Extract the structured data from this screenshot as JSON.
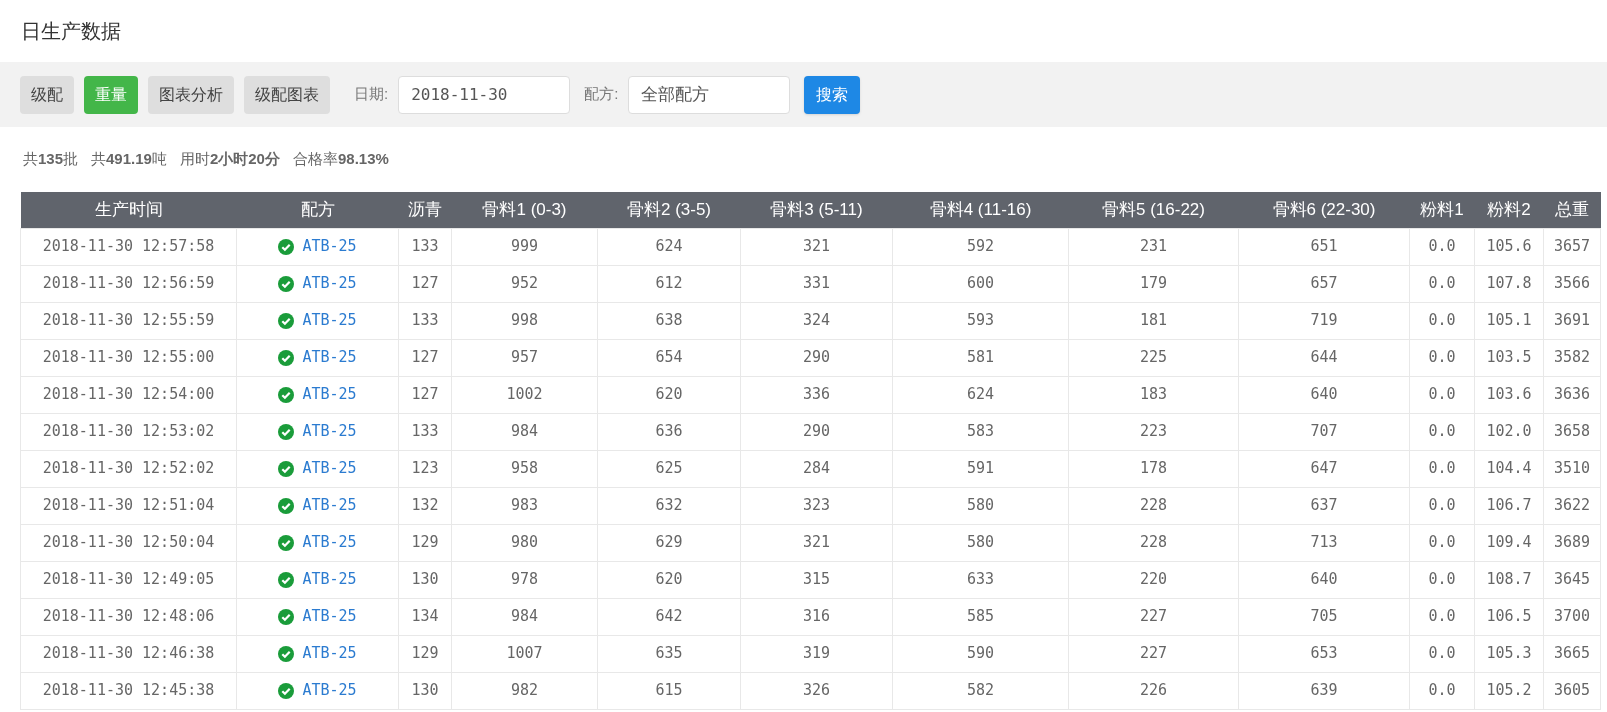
{
  "page_title": "日生产数据",
  "toolbar": {
    "tabs": [
      {
        "label": "级配",
        "selected": false
      },
      {
        "label": "重量",
        "selected": true
      },
      {
        "label": "图表分析",
        "selected": false
      },
      {
        "label": "级配图表",
        "selected": false
      }
    ],
    "date": {
      "label": "日期:",
      "value": "2018-11-30"
    },
    "recipe": {
      "label": "配方:",
      "value": "全部配方"
    },
    "search_button": "搜索"
  },
  "stats": [
    "共**135**批",
    "共**491.19**吨",
    "用时**2小时20分**",
    "合格率**98.13%**"
  ],
  "table": {
    "columns": [
      "生产时间",
      "配方",
      "沥青",
      "骨料1 (0-3)",
      "骨料2 (3-5)",
      "骨料3 (5-11)",
      "骨料4 (11-16)",
      "骨料5 (16-22)",
      "骨料6 (22-30)",
      "粉料1",
      "粉料2",
      "总重"
    ],
    "rows": [
      {
        "time": "2018-11-30 12:57:58",
        "passed": true,
        "recipe": "ATB-25",
        "values": [
          "133",
          "999",
          "624",
          "321",
          "592",
          "231",
          "651",
          "0.0",
          "105.6",
          "3657"
        ]
      },
      {
        "time": "2018-11-30 12:56:59",
        "passed": true,
        "recipe": "ATB-25",
        "values": [
          "127",
          "952",
          "612",
          "331",
          "600",
          "179",
          "657",
          "0.0",
          "107.8",
          "3566"
        ]
      },
      {
        "time": "2018-11-30 12:55:59",
        "passed": true,
        "recipe": "ATB-25",
        "values": [
          "133",
          "998",
          "638",
          "324",
          "593",
          "181",
          "719",
          "0.0",
          "105.1",
          "3691"
        ]
      },
      {
        "time": "2018-11-30 12:55:00",
        "passed": true,
        "recipe": "ATB-25",
        "values": [
          "127",
          "957",
          "654",
          "290",
          "581",
          "225",
          "644",
          "0.0",
          "103.5",
          "3582"
        ]
      },
      {
        "time": "2018-11-30 12:54:00",
        "passed": true,
        "recipe": "ATB-25",
        "values": [
          "127",
          "1002",
          "620",
          "336",
          "624",
          "183",
          "640",
          "0.0",
          "103.6",
          "3636"
        ]
      },
      {
        "time": "2018-11-30 12:53:02",
        "passed": true,
        "recipe": "ATB-25",
        "values": [
          "133",
          "984",
          "636",
          "290",
          "583",
          "223",
          "707",
          "0.0",
          "102.0",
          "3658"
        ]
      },
      {
        "time": "2018-11-30 12:52:02",
        "passed": true,
        "recipe": "ATB-25",
        "values": [
          "123",
          "958",
          "625",
          "284",
          "591",
          "178",
          "647",
          "0.0",
          "104.4",
          "3510"
        ]
      },
      {
        "time": "2018-11-30 12:51:04",
        "passed": true,
        "recipe": "ATB-25",
        "values": [
          "132",
          "983",
          "632",
          "323",
          "580",
          "228",
          "637",
          "0.0",
          "106.7",
          "3622"
        ]
      },
      {
        "time": "2018-11-30 12:50:04",
        "passed": true,
        "recipe": "ATB-25",
        "values": [
          "129",
          "980",
          "629",
          "321",
          "580",
          "228",
          "713",
          "0.0",
          "109.4",
          "3689"
        ]
      },
      {
        "time": "2018-11-30 12:49:05",
        "passed": true,
        "recipe": "ATB-25",
        "values": [
          "130",
          "978",
          "620",
          "315",
          "633",
          "220",
          "640",
          "0.0",
          "108.7",
          "3645"
        ]
      },
      {
        "time": "2018-11-30 12:48:06",
        "passed": true,
        "recipe": "ATB-25",
        "values": [
          "134",
          "984",
          "642",
          "316",
          "585",
          "227",
          "705",
          "0.0",
          "106.5",
          "3700"
        ]
      },
      {
        "time": "2018-11-30 12:46:38",
        "passed": true,
        "recipe": "ATB-25",
        "values": [
          "129",
          "1007",
          "635",
          "319",
          "590",
          "227",
          "653",
          "0.0",
          "105.3",
          "3665"
        ]
      },
      {
        "time": "2018-11-30 12:45:38",
        "passed": true,
        "recipe": "ATB-25",
        "values": [
          "130",
          "982",
          "615",
          "326",
          "582",
          "226",
          "639",
          "0.0",
          "105.2",
          "3605"
        ]
      }
    ]
  }
}
